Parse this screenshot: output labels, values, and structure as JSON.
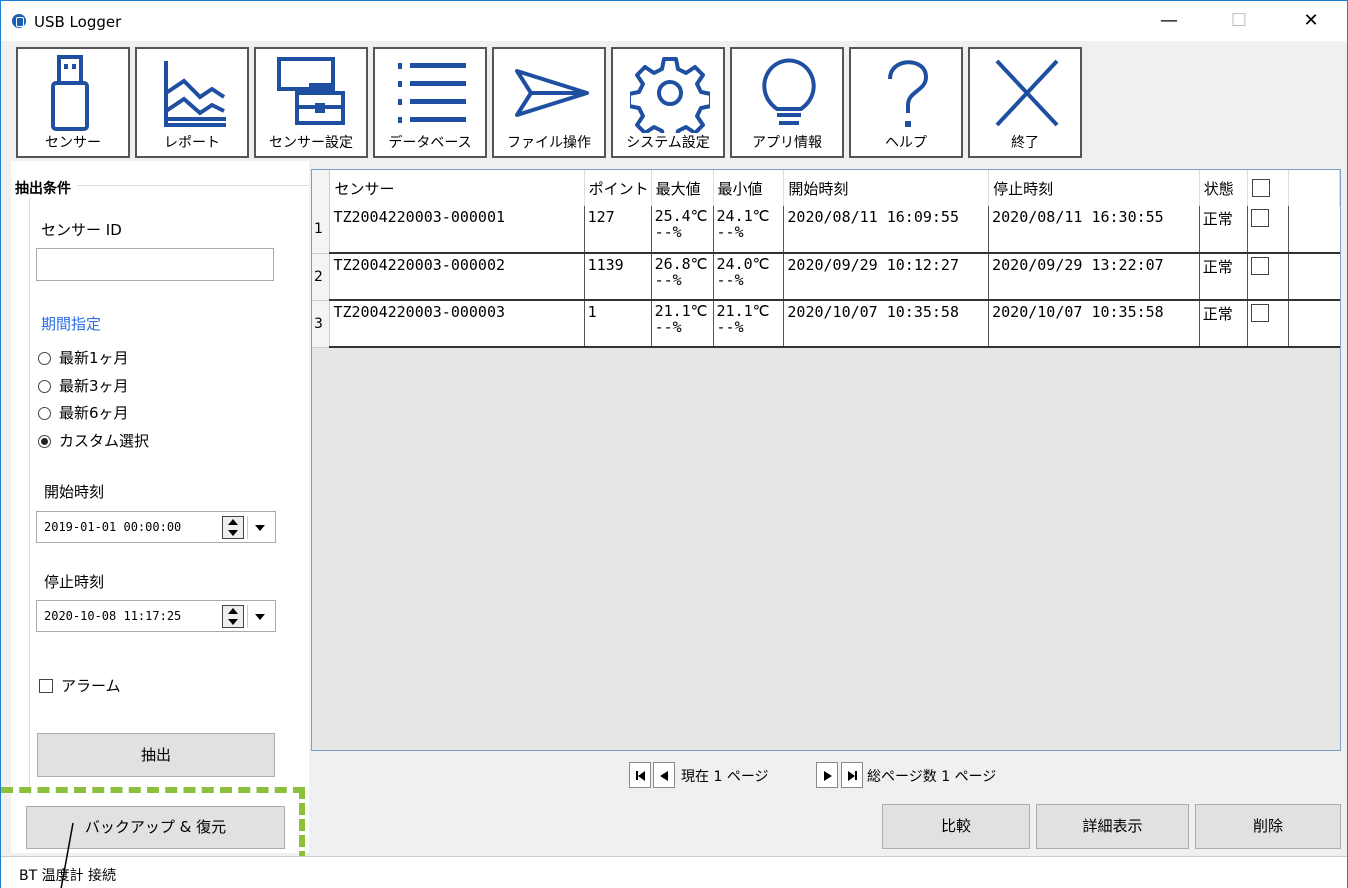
{
  "window": {
    "title": "USB Logger"
  },
  "toolbar": [
    {
      "label": "センサー",
      "icon": "usb-drive-icon"
    },
    {
      "label": "レポート",
      "icon": "report-chart-icon"
    },
    {
      "label": "センサー設定",
      "icon": "sensor-settings-icon"
    },
    {
      "label": "データベース",
      "icon": "database-list-icon"
    },
    {
      "label": "ファイル操作",
      "icon": "paper-plane-icon"
    },
    {
      "label": "システム設定",
      "icon": "gear-icon"
    },
    {
      "label": "アプリ情報",
      "icon": "lightbulb-icon"
    },
    {
      "label": "ヘルプ",
      "icon": "question-icon"
    },
    {
      "label": "終了",
      "icon": "close-x-icon"
    }
  ],
  "filter": {
    "group_title": "抽出条件",
    "sensor_id_label": "センサー ID",
    "sensor_id_value": "",
    "period_title": "期間指定",
    "period_options": [
      "最新1ヶ月",
      "最新3ヶ月",
      "最新6ヶ月",
      "カスタム選択"
    ],
    "period_selected": "カスタム選択",
    "start_label": "開始時刻",
    "start_value": "2019-01-01 00:00:00",
    "stop_label": "停止時刻",
    "stop_value": "2020-10-08 11:17:25",
    "alarm_label": "アラーム",
    "alarm_checked": false,
    "extract_button": "抽出"
  },
  "backup_button": "バックアップ & 復元",
  "table": {
    "columns": [
      "センサー",
      "ポイント",
      "最大値",
      "最小値",
      "開始時刻",
      "停止時刻",
      "状態"
    ],
    "rows": [
      {
        "num": "1",
        "sensor": "TZ2004220003-000001",
        "points": "127",
        "max_t": "25.4℃",
        "max_h": "--%",
        "min_t": "24.1℃",
        "min_h": "--%",
        "start": "2020/08/11 16:09:55",
        "stop": "2020/08/11 16:30:55",
        "status": "正常"
      },
      {
        "num": "2",
        "sensor": "TZ2004220003-000002",
        "points": "1139",
        "max_t": "26.8℃",
        "max_h": "--%",
        "min_t": "24.0℃",
        "min_h": "--%",
        "start": "2020/09/29 10:12:27",
        "stop": "2020/09/29 13:22:07",
        "status": "正常"
      },
      {
        "num": "3",
        "sensor": "TZ2004220003-000003",
        "points": "1",
        "max_t": "21.1℃",
        "max_h": "--%",
        "min_t": "21.1℃",
        "min_h": "--%",
        "start": "2020/10/07 10:35:58",
        "stop": "2020/10/07 10:35:58",
        "status": "正常"
      }
    ]
  },
  "pager": {
    "current_prefix": "現在",
    "current_page": "1",
    "page_unit": "ページ",
    "total_prefix": "総ページ数",
    "total_pages": "1"
  },
  "actions": {
    "compare": "比較",
    "detail": "詳細表示",
    "delete": "削除"
  },
  "status": {
    "text": "BT 温度計 接続"
  },
  "accent": {
    "dashed_highlight": "#8bbf3c",
    "icon_blue": "#1f4fa0",
    "period_title": "#2b6ee8"
  }
}
